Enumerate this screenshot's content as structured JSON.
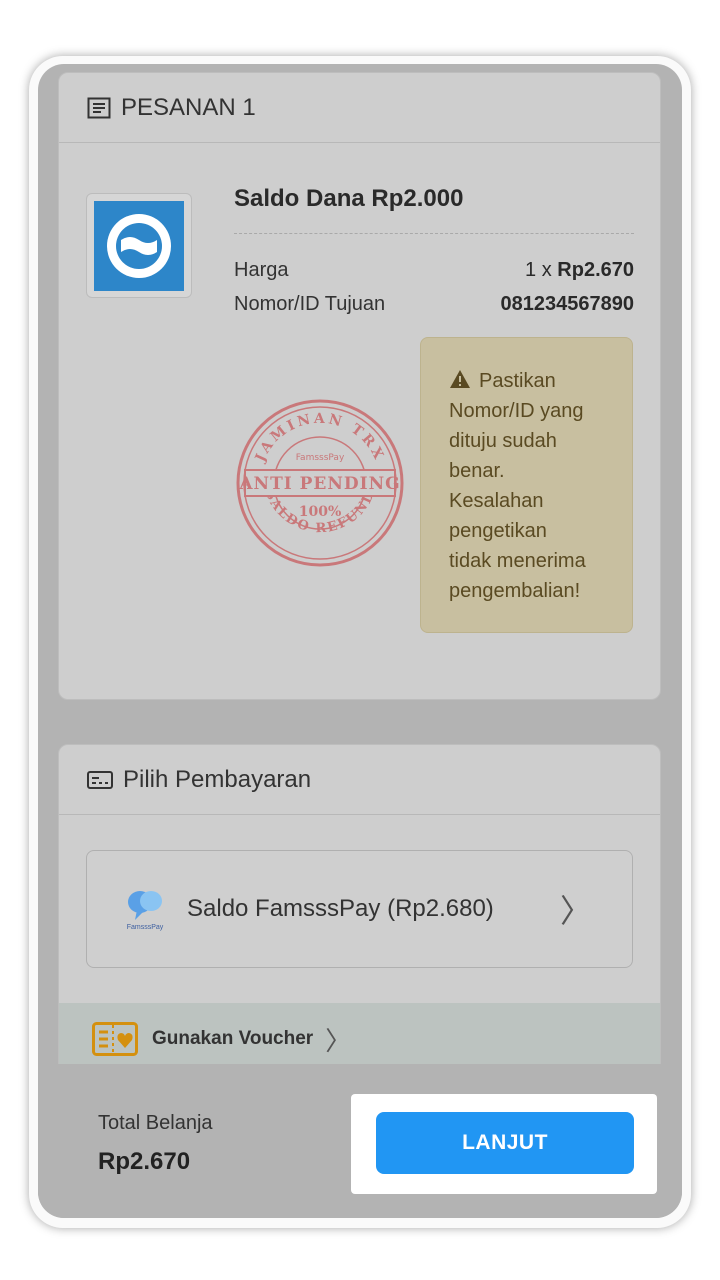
{
  "order": {
    "header": "PESANAN 1",
    "product_title": "Saldo Dana Rp2.000",
    "price_label": "Harga",
    "price_qty": "1 x ",
    "price_value": "Rp2.670",
    "dest_label": "Nomor/ID Tujuan",
    "dest_value": "081234567890",
    "warning_lines": [
      "Pastikan",
      "Nomor/ID yang",
      "dituju sudah",
      "benar.",
      "Kesalahan",
      "pengetikan",
      "tidak menerima",
      "pengembalian!"
    ],
    "stamp": {
      "top_text": "JAMINAN TRX",
      "brand": "FamsssPay",
      "middle_text": "ANTI PENDING",
      "percent": "100%",
      "bottom_text": "SALDO REFUND"
    }
  },
  "payment": {
    "header": "Pilih Pembayaran",
    "option_label": "Saldo FamsssPay (Rp2.680)",
    "option_logo_text": "FamsssPay",
    "voucher_label": "Gunakan Voucher"
  },
  "footer": {
    "total_label": "Total Belanja",
    "total_value": "Rp2.670",
    "button_label": "LANJUT"
  },
  "colors": {
    "accent": "#2196f3",
    "warning_bg": "#c8bfa0",
    "stamp": "#c9787a"
  }
}
